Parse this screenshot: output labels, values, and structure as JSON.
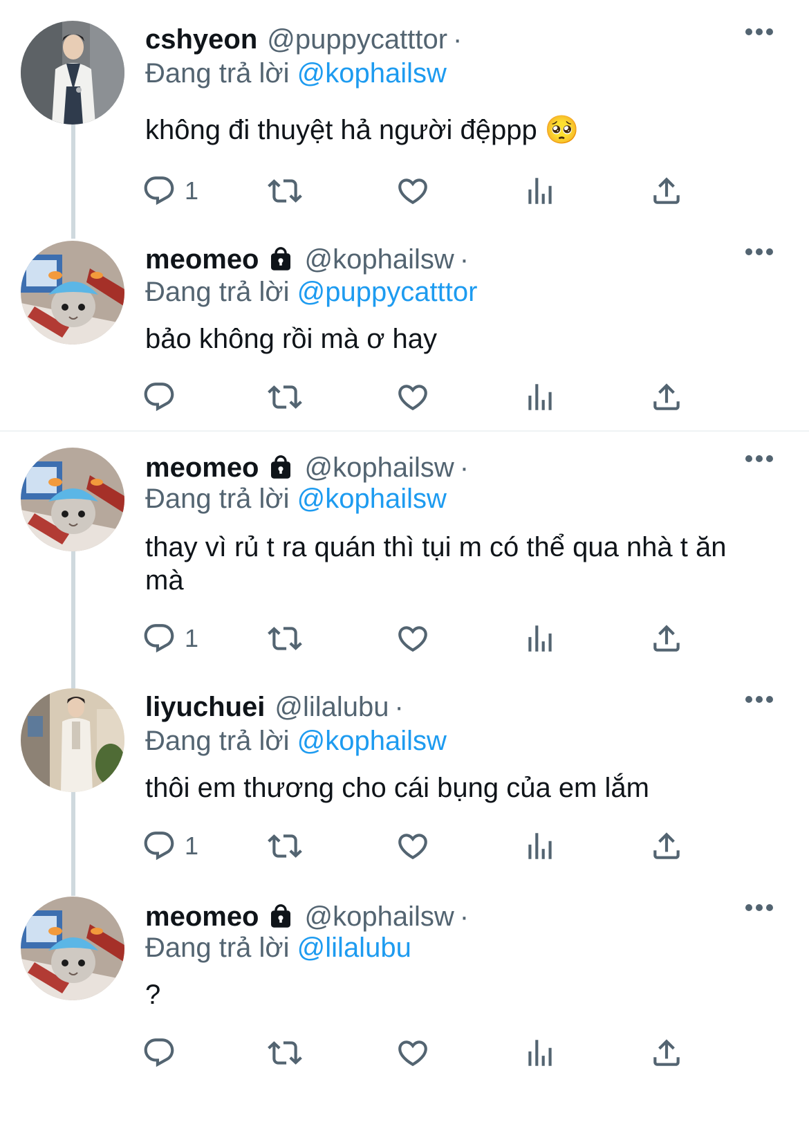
{
  "reply_prefix": "Đang trả lời",
  "colors": {
    "link": "#1d9bf0",
    "muted": "#536471",
    "text": "#0f1419"
  },
  "tweets": [
    {
      "name": "cshyeon",
      "handle": "@puppycatttor",
      "dot": "·",
      "locked": false,
      "reply_to": "@kophailsw",
      "text": "không đi thuyệt hả người đệppp 🥺",
      "reply_count": "1",
      "avatar_icon": "doctor-photo-avatar"
    },
    {
      "name": "meomeo",
      "handle": "@kophailsw",
      "dot": "·",
      "locked": true,
      "reply_to": "@puppycatttor",
      "text": "bảo không rồi mà ơ hay",
      "reply_count": "",
      "avatar_icon": "cat-with-surgical-cap-avatar"
    },
    {
      "name": "meomeo",
      "handle": "@kophailsw",
      "dot": "·",
      "locked": true,
      "reply_to": "@kophailsw",
      "text": "thay vì rủ t ra quán thì tụi m có thể qua nhà t ăn mà",
      "reply_count": "1",
      "avatar_icon": "cat-with-surgical-cap-avatar"
    },
    {
      "name": "liyuchuei",
      "handle": "@lilalubu",
      "dot": "·",
      "locked": false,
      "reply_to": "@kophailsw",
      "text": "thôi em thương cho cái bụng của em lắm",
      "reply_count": "1",
      "avatar_icon": "doctor-in-clinic-avatar"
    },
    {
      "name": "meomeo",
      "handle": "@kophailsw",
      "dot": "·",
      "locked": true,
      "reply_to": "@lilalubu",
      "text": "?",
      "reply_count": "",
      "avatar_icon": "cat-with-surgical-cap-avatar"
    }
  ]
}
